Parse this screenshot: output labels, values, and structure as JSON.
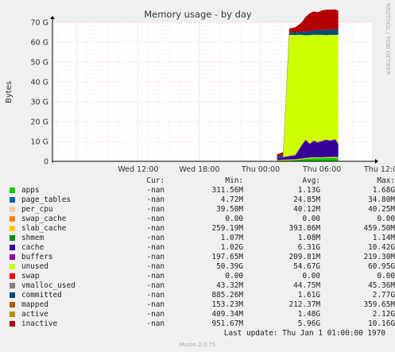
{
  "side_label": "RRDTOOL / TOBI OETIKER",
  "last_update": "Last update:  Thu Jan  1 01:00:00 1970",
  "munin_version": "Munin 2.0.75",
  "legend_headers": {
    "cur": "Cur:",
    "min": "Min:",
    "avg": "Avg:",
    "max": "Max:"
  },
  "legend": [
    {
      "name": "apps",
      "color": "#00cc00",
      "cur": "-nan",
      "min": "311.56M",
      "avg": "1.13G",
      "max": "1.68G"
    },
    {
      "name": "page_tables",
      "color": "#0066b3",
      "cur": "-nan",
      "min": "4.72M",
      "avg": "24.85M",
      "max": "34.80M"
    },
    {
      "name": "per_cpu",
      "color": "#ffcc99",
      "cur": "-nan",
      "min": "39.50M",
      "avg": "40.12M",
      "max": "40.25M"
    },
    {
      "name": "swap_cache",
      "color": "#ff8000",
      "cur": "-nan",
      "min": "0.00",
      "avg": "0.00",
      "max": "0.00"
    },
    {
      "name": "slab_cache",
      "color": "#ffcc00",
      "cur": "-nan",
      "min": "259.19M",
      "avg": "393.86M",
      "max": "459.50M"
    },
    {
      "name": "shmem",
      "color": "#008f00",
      "cur": "-nan",
      "min": "1.07M",
      "avg": "1.08M",
      "max": "1.14M"
    },
    {
      "name": "cache",
      "color": "#330099",
      "cur": "-nan",
      "min": "1.02G",
      "avg": "6.31G",
      "max": "10.42G"
    },
    {
      "name": "buffers",
      "color": "#990099",
      "cur": "-nan",
      "min": "197.65M",
      "avg": "209.81M",
      "max": "219.30M"
    },
    {
      "name": "unused",
      "color": "#ccff00",
      "cur": "-nan",
      "min": "50.39G",
      "avg": "54.67G",
      "max": "60.95G"
    },
    {
      "name": "swap",
      "color": "#ff0000",
      "cur": "-nan",
      "min": "0.00",
      "avg": "0.00",
      "max": "0.00"
    },
    {
      "name": "vmalloc_used",
      "color": "#808080",
      "cur": "-nan",
      "min": "43.32M",
      "avg": "44.75M",
      "max": "45.36M"
    },
    {
      "name": "committed",
      "color": "#004c77",
      "cur": "-nan",
      "min": "885.26M",
      "avg": "1.61G",
      "max": "2.77G"
    },
    {
      "name": "mapped",
      "color": "#b35900",
      "cur": "-nan",
      "min": "153.23M",
      "avg": "212.37M",
      "max": "359.65M"
    },
    {
      "name": "active",
      "color": "#b38f00",
      "cur": "-nan",
      "min": "409.34M",
      "avg": "1.48G",
      "max": "2.12G"
    },
    {
      "name": "inactive",
      "color": "#b30000",
      "cur": "-nan",
      "min": "951.67M",
      "avg": "5.96G",
      "max": "10.16G"
    }
  ],
  "chart_data": {
    "type": "area",
    "title": "Memory usage - by day",
    "ylabel": "Bytes",
    "ylim_gb": [
      0,
      70
    ],
    "y_ticks": [
      {
        "value": 0,
        "label": "0"
      },
      {
        "value": 10,
        "label": "10 G"
      },
      {
        "value": 20,
        "label": "20 G"
      },
      {
        "value": 30,
        "label": "30 G"
      },
      {
        "value": 40,
        "label": "40 G"
      },
      {
        "value": 50,
        "label": "50 G"
      },
      {
        "value": 60,
        "label": "60 G"
      },
      {
        "value": 70,
        "label": "70 G"
      }
    ],
    "x_ticks": [
      "Wed 12:00",
      "Wed 18:00",
      "Thu 00:00",
      "Thu 06:00",
      "Thu 12:00"
    ],
    "x_range_hours": [
      -8.4,
      22.9
    ],
    "grid": true,
    "x_hours": [
      13.6,
      14.2,
      14.8,
      15.4,
      16.0,
      16.4,
      16.8,
      17.2,
      17.6,
      18.0,
      18.4,
      18.8,
      19.3,
      19.6
    ],
    "series": [
      {
        "name": "apps",
        "values": [
          0.3,
          0.4,
          0.5,
          0.6,
          0.9,
          1.2,
          1.4,
          1.5,
          1.5,
          1.5,
          1.6,
          1.6,
          1.7,
          1.6
        ]
      },
      {
        "name": "page_tables",
        "values": [
          0.005,
          0.01,
          0.02,
          0.02,
          0.03,
          0.03,
          0.03,
          0.03,
          0.03,
          0.03,
          0.03,
          0.03,
          0.03,
          0.03
        ]
      },
      {
        "name": "per_cpu",
        "values": [
          0.04,
          0.04,
          0.04,
          0.04,
          0.04,
          0.04,
          0.04,
          0.04,
          0.04,
          0.04,
          0.04,
          0.04,
          0.04,
          0.04
        ]
      },
      {
        "name": "slab_cache",
        "values": [
          0.26,
          0.3,
          0.33,
          0.35,
          0.4,
          0.42,
          0.44,
          0.45,
          0.45,
          0.45,
          0.46,
          0.46,
          0.46,
          0.46
        ]
      },
      {
        "name": "shmem",
        "values": [
          0.001,
          0.001,
          0.001,
          0.001,
          0.001,
          0.001,
          0.001,
          0.001,
          0.001,
          0.001,
          0.001,
          0.001,
          0.001,
          0.001
        ]
      },
      {
        "name": "cache",
        "values": [
          0.8,
          1.2,
          1.6,
          2.0,
          6.5,
          9.0,
          6.8,
          8.2,
          7.4,
          8.0,
          8.6,
          8.1,
          8.7,
          6.6
        ]
      },
      {
        "name": "buffers",
        "values": [
          0.2,
          0.2,
          0.2,
          0.21,
          0.21,
          0.21,
          0.21,
          0.21,
          0.22,
          0.22,
          0.22,
          0.22,
          0.22,
          0.22
        ]
      },
      {
        "name": "unused",
        "values": [
          0.0,
          0.0,
          60.95,
          60.4,
          55.6,
          52.5,
          54.6,
          53.3,
          54.0,
          53.4,
          52.6,
          53.2,
          52.5,
          54.7
        ]
      },
      {
        "name": "committed",
        "values": [
          0.9,
          1.0,
          1.2,
          1.4,
          1.6,
          1.8,
          2.0,
          2.2,
          2.4,
          2.5,
          2.6,
          2.7,
          2.7,
          2.7
        ]
      },
      {
        "name": "inactive",
        "values": [
          0.95,
          1.5,
          2.0,
          2.5,
          4.5,
          7.5,
          9.0,
          9.5,
          9.0,
          9.8,
          10.16,
          10.0,
          10.1,
          9.5
        ]
      }
    ]
  }
}
